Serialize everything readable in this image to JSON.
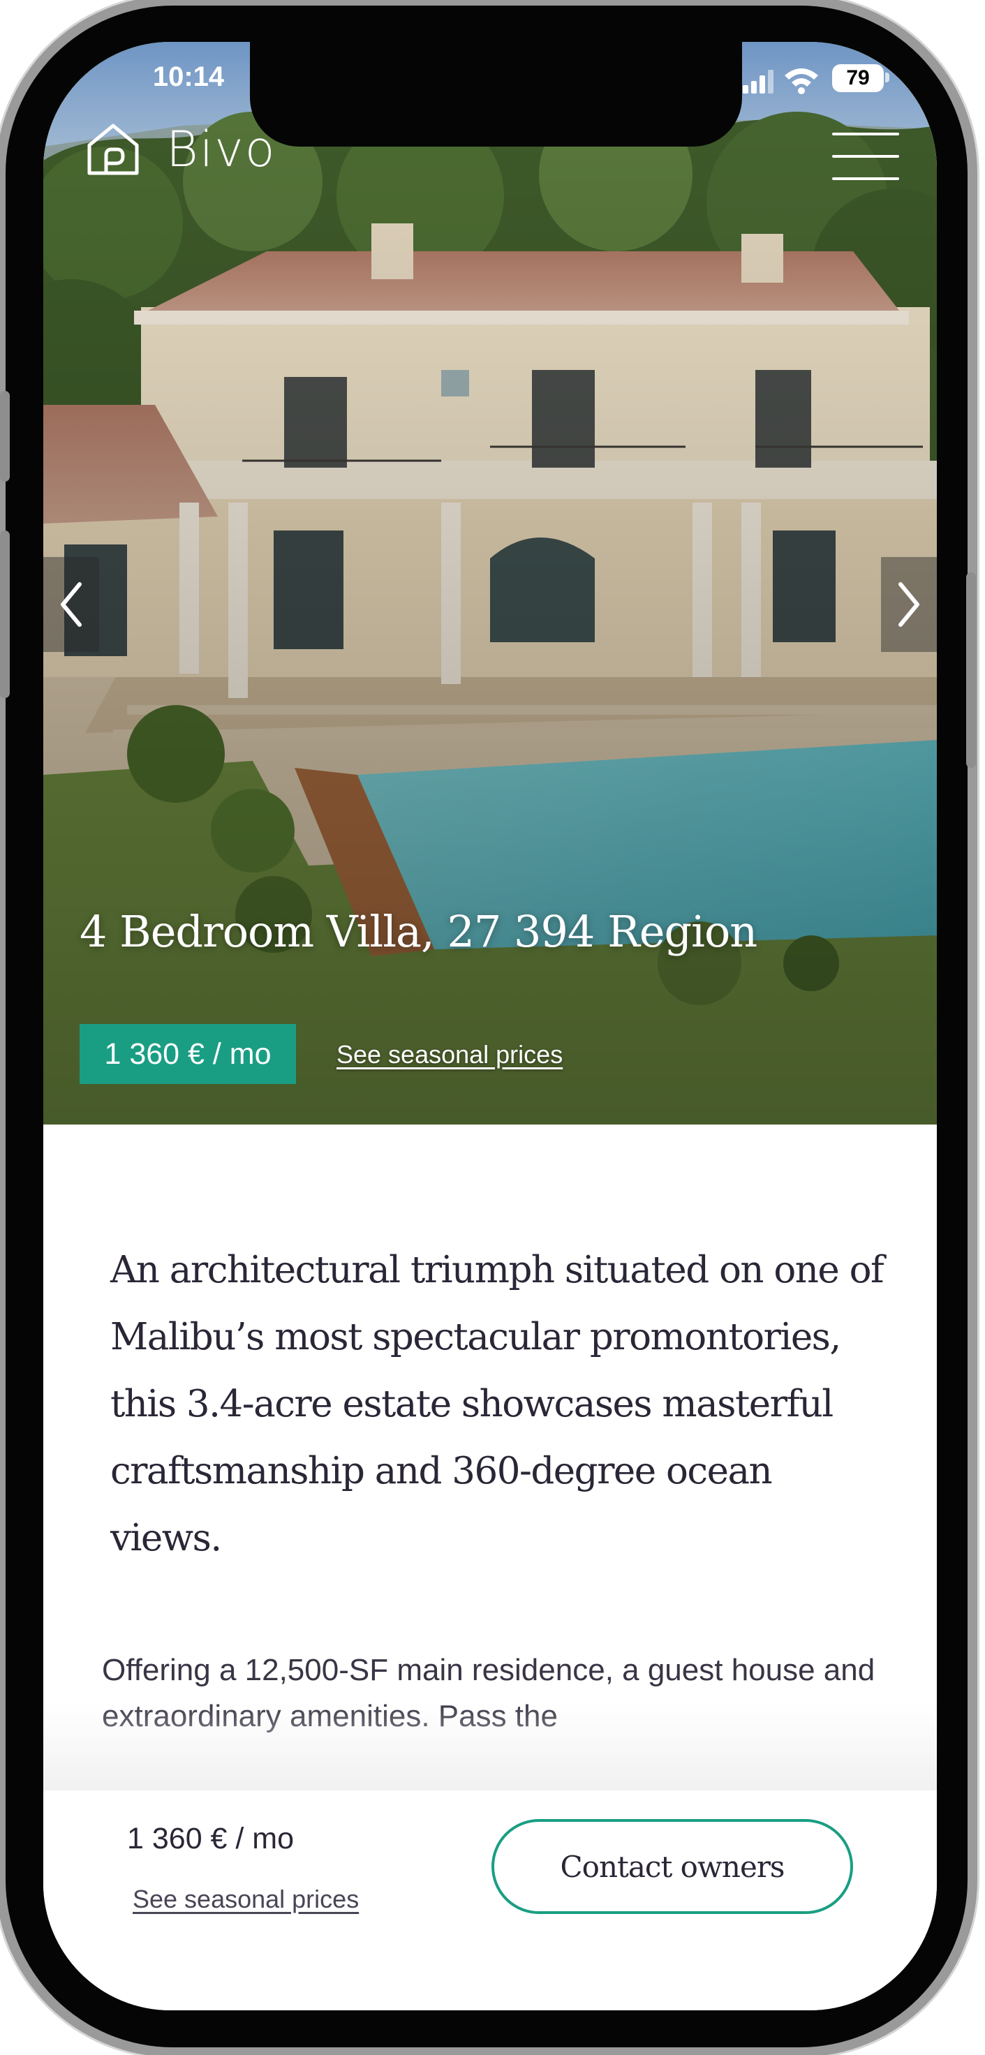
{
  "status_bar": {
    "time": "10:14",
    "battery": "79"
  },
  "header": {
    "brand": "Bivo"
  },
  "hero": {
    "title": "4 Bedroom Villa, 27 394 Region",
    "price": "1 360 € / mo",
    "seasonal_link": "See seasonal prices"
  },
  "description": {
    "lead": "An architectural triumph situated on one of Malibu’s most spectacular promontories, this 3.4-acre estate showcases masterful craftsmanship and 360-degree ocean views.",
    "body": "Offering a 12,500-SF main residence, a guest house and extraordinary amenities. Pass the"
  },
  "bottom_bar": {
    "price": "1 360 € / mo",
    "seasonal_link": "See seasonal prices",
    "contact_label": "Contact owners"
  },
  "colors": {
    "accent": "#1a9e83",
    "text_dark": "#2b2636"
  }
}
